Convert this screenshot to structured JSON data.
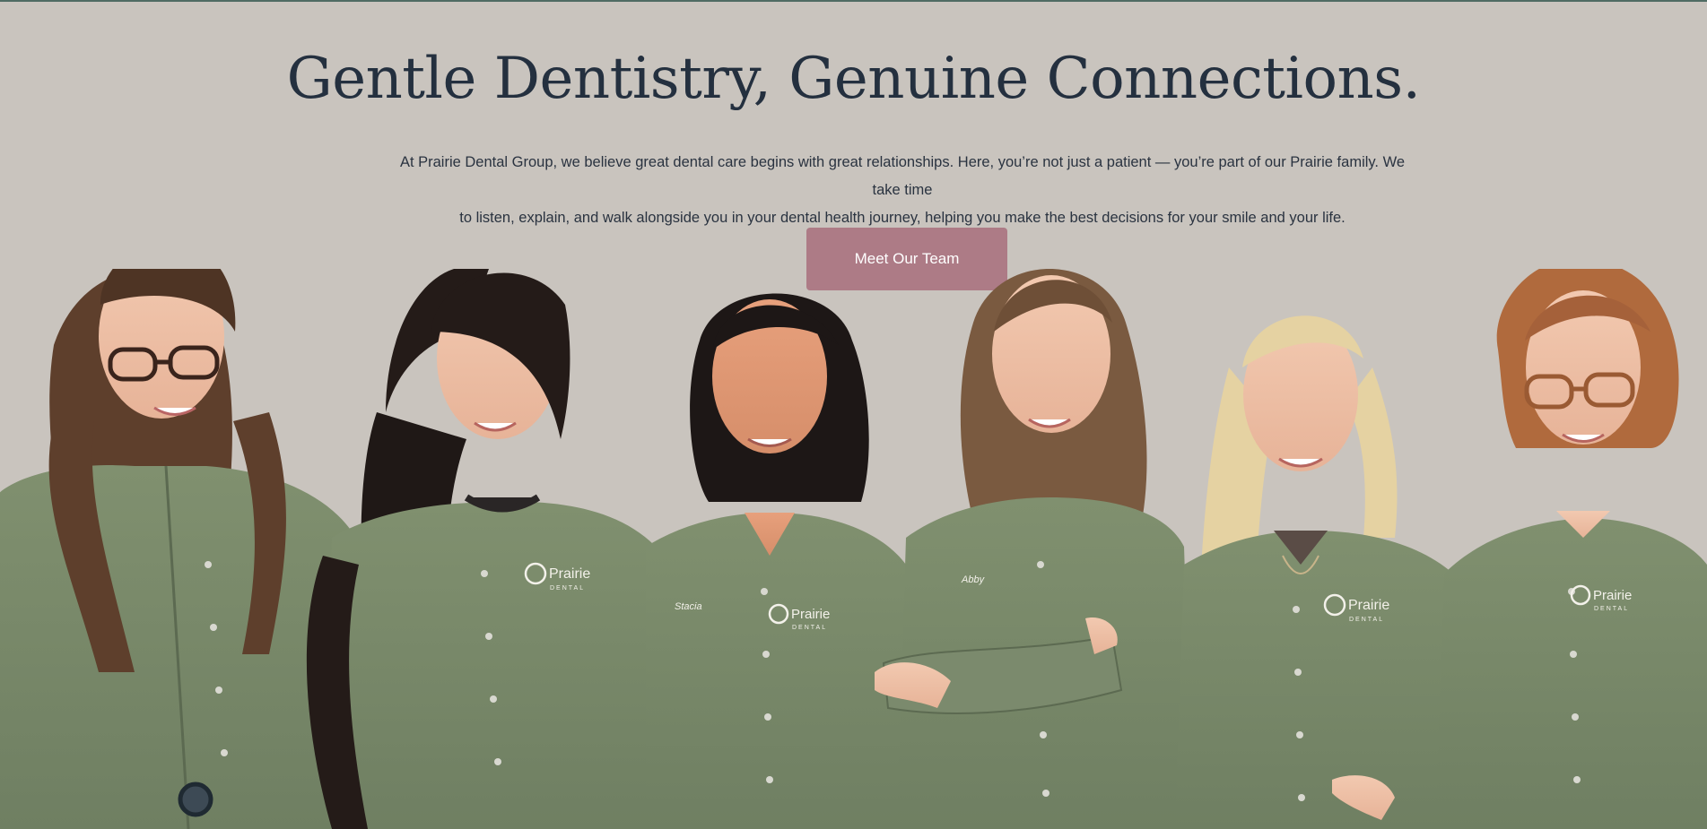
{
  "hero": {
    "headline": "Gentle Dentistry, Genuine Connections.",
    "intro_line_1": "At Prairie Dental Group, we believe great dental care begins with great relationships. Here, you’re not just a patient — you’re part of our Prairie family. We take time",
    "intro_line_2": "to listen, explain, and walk alongside you in your dental health journey, helping you make the best decisions for your smile and your life.",
    "cta_label": "Meet Our Team"
  },
  "team_photo": {
    "logo_text": "Prairie",
    "logo_subtext": "DENTAL",
    "name_tags": [
      "Stacia",
      "Abby"
    ],
    "colors": {
      "background": "#c9c4be",
      "uniform": "#7b8a6d",
      "headline": "#24303f",
      "button": "#ad7b86"
    }
  }
}
